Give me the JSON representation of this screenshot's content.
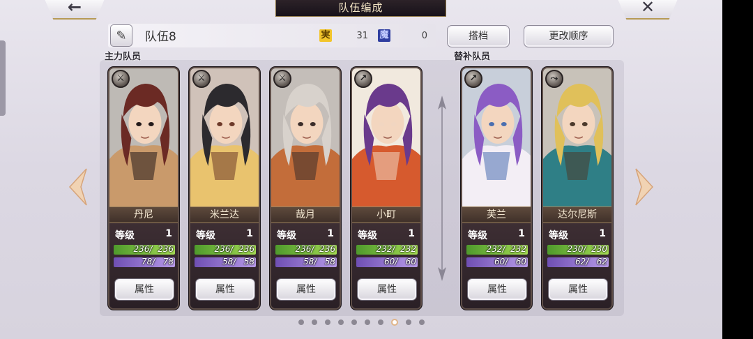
{
  "header": {
    "title": "队伍编成",
    "back_icon": "arrow-left-icon",
    "close_icon": "close-x-icon"
  },
  "team": {
    "name": "队伍8",
    "stat_a_value": "31",
    "stat_b_value": "0",
    "partner_label": "搭档",
    "reorder_label": "更改顺序"
  },
  "sections": {
    "main_label": "主力队员",
    "sub_label": "替补队员"
  },
  "colors": {
    "hp": "#8fcf48",
    "mp": "#a88be0",
    "frame": "#5e4e48",
    "accent_gold": "#b69a55"
  },
  "cards": [
    {
      "name": "丹尼",
      "level_label": "等级",
      "level": "1",
      "hp_text": "236/  236",
      "hp_ratio": 1.0,
      "mp_text": "78/   78",
      "mp_ratio": 1.0,
      "attr_label": "属性",
      "class_icon": "axe-icon",
      "palette": [
        "#6b2a24",
        "#c99a6b",
        "#231a1a"
      ]
    },
    {
      "name": "米兰达",
      "level_label": "等级",
      "level": "1",
      "hp_text": "236/  236",
      "hp_ratio": 1.0,
      "mp_text": "58/   58",
      "mp_ratio": 1.0,
      "attr_label": "属性",
      "class_icon": "axe-icon",
      "palette": [
        "#2c2a2e",
        "#e9c36e",
        "#6d3a2a"
      ]
    },
    {
      "name": "哉月",
      "level_label": "等级",
      "level": "1",
      "hp_text": "236/  236",
      "hp_ratio": 1.0,
      "mp_text": "58/   58",
      "mp_ratio": 1.0,
      "attr_label": "属性",
      "class_icon": "axe-icon",
      "palette": [
        "#d8d2cc",
        "#c36d3a",
        "#3b2d2a"
      ]
    },
    {
      "name": "小町",
      "level_label": "等级",
      "level": "1",
      "hp_text": "232/  232",
      "hp_ratio": 1.0,
      "mp_text": "60/   60",
      "mp_ratio": 1.0,
      "attr_label": "属性",
      "class_icon": "spear-icon",
      "palette": [
        "#6a3a8c",
        "#d65a2e",
        "#f1d6c1"
      ]
    },
    {
      "name": "芙兰",
      "level_label": "等级",
      "level": "1",
      "hp_text": "232/  232",
      "hp_ratio": 1.0,
      "mp_text": "60/   60",
      "mp_ratio": 1.0,
      "attr_label": "属性",
      "class_icon": "spear-icon",
      "palette": [
        "#8b5cc4",
        "#f3eef5",
        "#4a6fb0"
      ]
    },
    {
      "name": "达尔尼斯",
      "level_label": "等级",
      "level": "1",
      "hp_text": "230/  230",
      "hp_ratio": 1.0,
      "mp_text": "62/   62",
      "mp_ratio": 1.0,
      "attr_label": "属性",
      "class_icon": "bow-icon",
      "palette": [
        "#e0c05a",
        "#2f7f86",
        "#4b3a2c"
      ]
    }
  ],
  "pagination": {
    "count": 10,
    "active": 7
  }
}
